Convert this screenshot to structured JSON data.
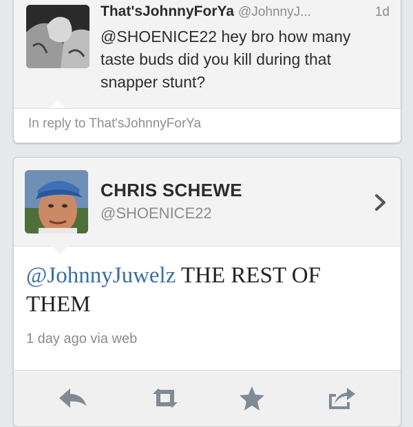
{
  "reply_tweet": {
    "display_name": "That'sJohnnyForYa",
    "handle": "@JohnnyJ...",
    "time": "1d",
    "text": "@SHOENICE22 hey bro how many taste buds did you kill during that snapper stunt?",
    "in_reply_to": "In reply to That'sJohnnyForYa"
  },
  "profile": {
    "name": "CHRIS SCHEWE",
    "handle": "@SHOENICE22"
  },
  "tweet": {
    "mention": "@JohnnyJuwelz",
    "text": " THE REST OF THEM",
    "meta": "1 day ago via web"
  },
  "actions": {
    "reply_icon": "reply-arrow-icon",
    "retweet_icon": "retweet-icon",
    "favorite_icon": "star-icon",
    "share_icon": "share-icon"
  },
  "colors": {
    "mention": "#3a6ea5",
    "background": "#e6e8ec",
    "icon": "#7f8a95"
  }
}
